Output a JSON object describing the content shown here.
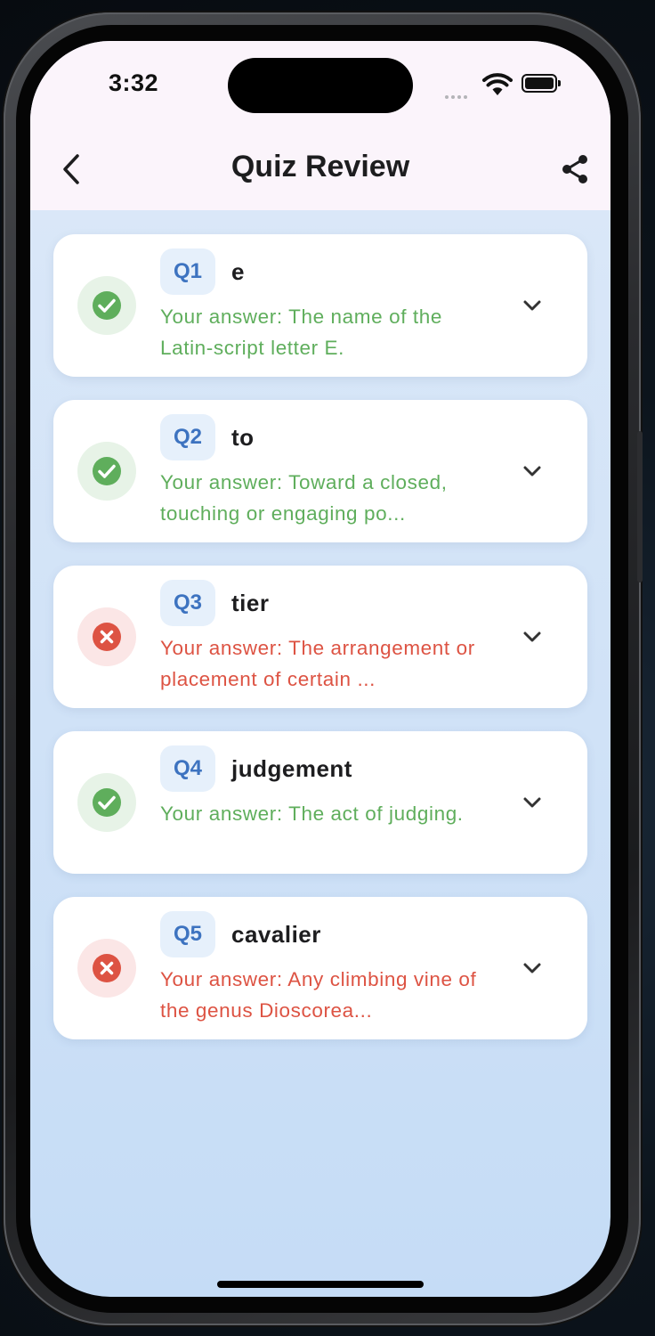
{
  "status_bar": {
    "time": "3:32"
  },
  "header": {
    "title": "Quiz Review",
    "back_icon": "chevron-left-icon",
    "share_icon": "share-icon"
  },
  "colors": {
    "correct": "#5fae5c",
    "incorrect": "#dd5343",
    "chip_text": "#3d73c0",
    "chip_bg": "#e6f0fb"
  },
  "questions": [
    {
      "number": "Q1",
      "word": "e",
      "answer": "Your answer: The name of the Latin-script letter E.",
      "result": "correct"
    },
    {
      "number": "Q2",
      "word": "to",
      "answer": "Your answer: Toward a closed, touching or engaging po...",
      "result": "correct"
    },
    {
      "number": "Q3",
      "word": "tier",
      "answer": "Your answer: The arrangement or placement of certain ...",
      "result": "incorrect"
    },
    {
      "number": "Q4",
      "word": "judgement",
      "answer": "Your answer: The act of judging.",
      "result": "correct"
    },
    {
      "number": "Q5",
      "word": "cavalier",
      "answer": "Your answer: Any climbing vine of the genus Dioscorea...",
      "result": "incorrect"
    }
  ]
}
